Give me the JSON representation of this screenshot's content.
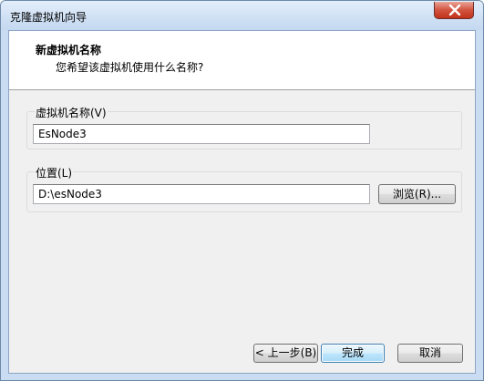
{
  "window": {
    "title": "克隆虚拟机向导"
  },
  "header": {
    "title": "新虚拟机名称",
    "subtitle": "您希望该虚拟机使用什么名称?"
  },
  "name_group": {
    "label": "虚拟机名称(V)",
    "value": "EsNode3"
  },
  "location_group": {
    "label": "位置(L)",
    "value": "D:\\esNode3",
    "browse_label": "浏览(R)..."
  },
  "footer": {
    "back_label": "< 上一步(B)",
    "finish_label": "完成",
    "cancel_label": "取消"
  },
  "icons": {
    "close": "close-icon"
  },
  "colors": {
    "close_button": "#c8402a",
    "title_bar": "#cfe0f4",
    "header_bg": "#ffffff",
    "body_bg": "#f0f0f0"
  }
}
